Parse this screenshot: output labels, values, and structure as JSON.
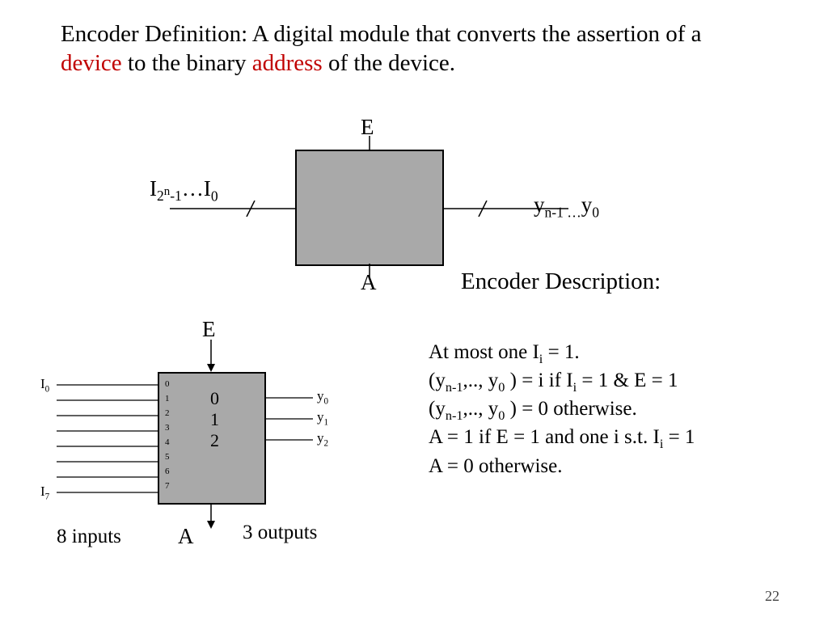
{
  "definition": {
    "t1": "Encoder Definition: A digital module that converts the assertion of a ",
    "t2": "device",
    "t3": " to the binary ",
    "t4": "address",
    "t5": " of the device."
  },
  "diag1": {
    "E": "E",
    "A": "A",
    "in_left": "I",
    "out_y": "y"
  },
  "diag2": {
    "E": "E",
    "A": "A",
    "I0": "I",
    "I7": "I",
    "y0": "y",
    "y1": "y",
    "y2": "y",
    "inputs_label": "8 inputs",
    "outputs_label": "3 outputs",
    "left_nums": [
      "0",
      "1",
      "2",
      "3",
      "4",
      "5",
      "6",
      "7"
    ],
    "right_nums": [
      "0",
      "1",
      "2"
    ]
  },
  "desc": {
    "title": "Encoder Description:",
    "l1a": "At most one I",
    "l1b": " = 1.",
    "l2a": "(y",
    "l2b": ",.., y",
    "l2c": " ) = i if I",
    "l2d": " = 1 &  E = 1",
    "l3a": "(y",
    "l3b": ",.., y",
    "l3c": " ) = 0 otherwise.",
    "l4a": "A = 1 if E = 1 and one i s.t. I",
    "l4b": " = 1",
    "l5": "A = 0 otherwise."
  },
  "slide_number": "22"
}
